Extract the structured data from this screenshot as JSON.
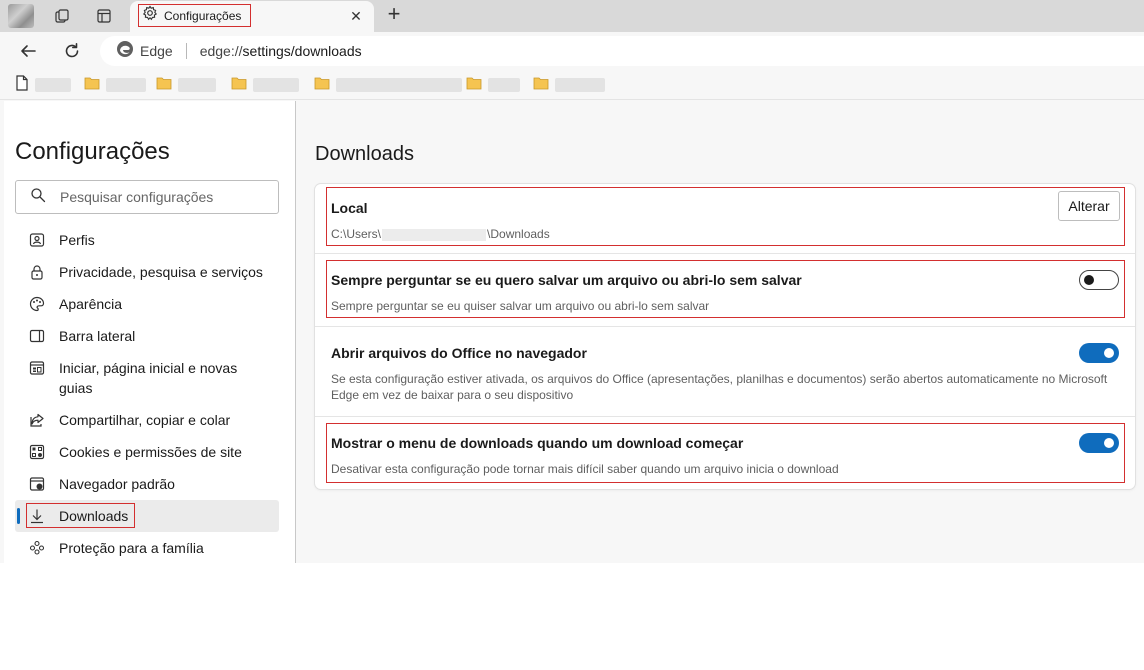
{
  "tab": {
    "title": "Configurações",
    "close": "✕",
    "new_tab": "+"
  },
  "address_bar": {
    "site_label": "Edge",
    "url_prefix": "edge://",
    "url_path": "settings/downloads"
  },
  "favorites": [
    "",
    "",
    "",
    "",
    "",
    "",
    ""
  ],
  "sidebar": {
    "title": "Configurações",
    "search_placeholder": "Pesquisar configurações",
    "items": [
      {
        "label": "Perfis",
        "icon": "profile-icon"
      },
      {
        "label": "Privacidade, pesquisa e serviços",
        "icon": "lock-icon"
      },
      {
        "label": "Aparência",
        "icon": "palette-icon"
      },
      {
        "label": "Barra lateral",
        "icon": "sidebar-icon"
      },
      {
        "label": "Iniciar, página inicial e novas guias",
        "icon": "home-tabs-icon"
      },
      {
        "label": "Compartilhar, copiar e colar",
        "icon": "share-icon"
      },
      {
        "label": "Cookies e permissões de site",
        "icon": "cookies-icon"
      },
      {
        "label": "Navegador padrão",
        "icon": "default-browser-icon"
      },
      {
        "label": "Downloads",
        "icon": "download-icon",
        "selected": true
      },
      {
        "label": "Proteção para a família",
        "icon": "family-icon"
      }
    ]
  },
  "main": {
    "heading": "Downloads",
    "location": {
      "title": "Local",
      "path_prefix": "C:\\Users\\",
      "path_suffix": "\\Downloads",
      "button": "Alterar"
    },
    "settings": [
      {
        "title": "Sempre perguntar se eu quero salvar um arquivo ou abri-lo sem salvar",
        "description": "Sempre perguntar se eu quiser salvar um arquivo ou abri-lo sem salvar",
        "enabled": false
      },
      {
        "title": "Abrir arquivos do Office no navegador",
        "description": "Se esta configuração estiver ativada, os arquivos do Office (apresentações, planilhas e documentos) serão abertos automaticamente no Microsoft Edge em vez de baixar para o seu dispositivo",
        "enabled": true
      },
      {
        "title": "Mostrar o menu de downloads quando um download começar",
        "description": "Desativar esta configuração pode tornar mais difícil saber quando um arquivo inicia o download",
        "enabled": true
      }
    ]
  },
  "colors": {
    "accent": "#0f6cbd",
    "highlight_border": "#d32f2f",
    "folder": "#f5c451"
  }
}
